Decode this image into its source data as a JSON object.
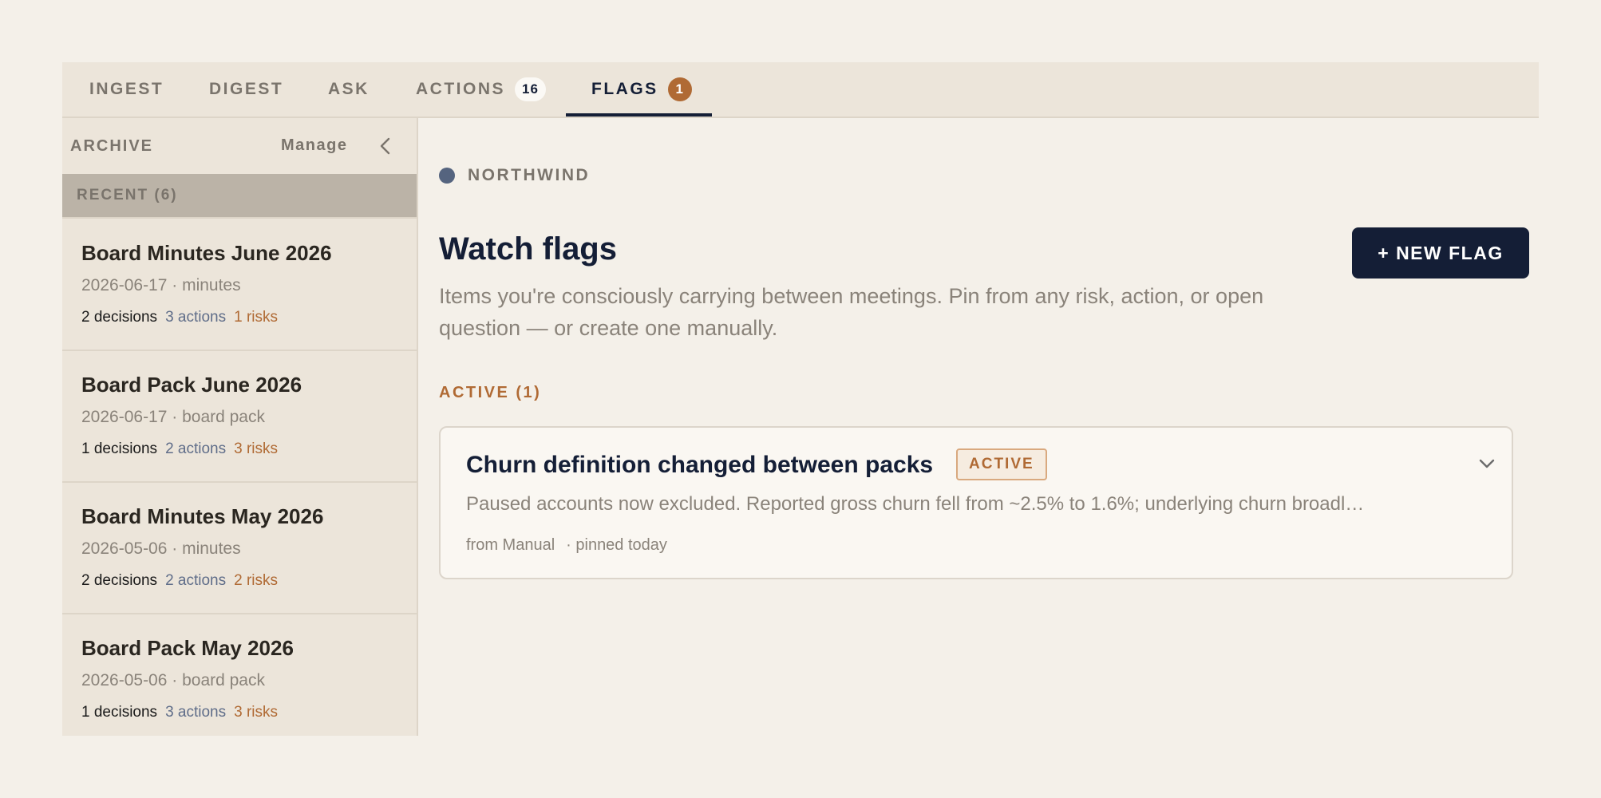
{
  "tabs": [
    {
      "label": "INGEST"
    },
    {
      "label": "DIGEST"
    },
    {
      "label": "ASK"
    },
    {
      "label": "ACTIONS",
      "count": "16"
    },
    {
      "label": "FLAGS",
      "count": "1",
      "active": true
    }
  ],
  "sidebar": {
    "title": "ARCHIVE",
    "manage_label": "Manage",
    "collapse_icon": "chevron-left-icon",
    "recent_label": "RECENT (6)",
    "documents": [
      {
        "title": "Board Minutes June 2026",
        "meta": "2026-06-17 · minutes",
        "decisions": "2 decisions",
        "actions": "3 actions",
        "risks": "1 risks"
      },
      {
        "title": "Board Pack June 2026",
        "meta": "2026-06-17 · board pack",
        "decisions": "1 decisions",
        "actions": "2 actions",
        "risks": "3 risks"
      },
      {
        "title": "Board Minutes May 2026",
        "meta": "2026-05-06 · minutes",
        "decisions": "2 decisions",
        "actions": "2 actions",
        "risks": "2 risks"
      },
      {
        "title": "Board Pack May 2026",
        "meta": "2026-05-06 · board pack",
        "decisions": "1 decisions",
        "actions": "3 actions",
        "risks": "3 risks"
      }
    ]
  },
  "main": {
    "org_name": "NORTHWIND",
    "title": "Watch flags",
    "description": "Items you're consciously carrying between meetings. Pin from any risk, action, or open question — or create one manually.",
    "new_flag_label": "+ NEW FLAG",
    "section_label": "ACTIVE (1)",
    "flags": [
      {
        "title": "Churn definition changed between packs",
        "status": "ACTIVE",
        "body": "Paused accounts now excluded. Reported gross churn fell from ~2.5% to 1.6%; underlying churn broadl…",
        "source": "from Manual",
        "pinned": "· pinned today"
      }
    ]
  },
  "colors": {
    "background": "#f4f0e9",
    "navy": "#141e36",
    "accent": "#b06a34",
    "muted": "#8a837a",
    "action_blue": "#5f6d89",
    "org_dot": "#55647f"
  }
}
